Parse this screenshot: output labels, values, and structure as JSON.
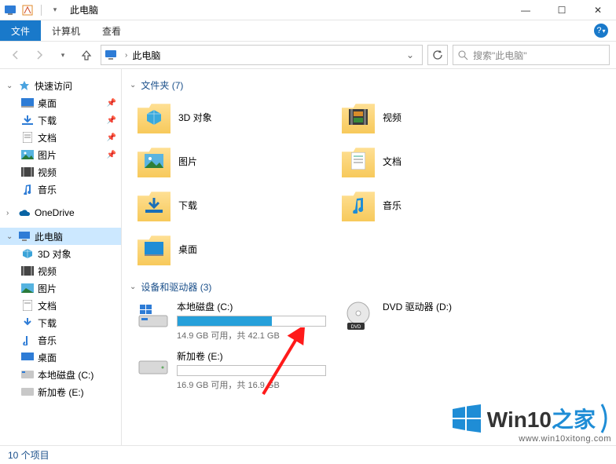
{
  "window": {
    "title": "此电脑",
    "min": "—",
    "max": "☐",
    "close": "✕"
  },
  "ribbon": {
    "file": "文件",
    "computer": "计算机",
    "view": "查看",
    "help": "?"
  },
  "address": {
    "path": "此电脑",
    "search_placeholder": "搜索\"此电脑\""
  },
  "sidebar": {
    "quick_access": "快速访问",
    "desktop": "桌面",
    "downloads": "下载",
    "documents": "文档",
    "pictures": "图片",
    "videos": "视频",
    "music": "音乐",
    "onedrive": "OneDrive",
    "this_pc": "此电脑",
    "objects3d": "3D 对象",
    "videos2": "视频",
    "pictures2": "图片",
    "documents2": "文档",
    "downloads2": "下载",
    "music2": "音乐",
    "desktop2": "桌面",
    "drive_c": "本地磁盘 (C:)",
    "drive_e": "新加卷 (E:)"
  },
  "sections": {
    "folders": {
      "title": "文件夹 (7)"
    },
    "devices": {
      "title": "设备和驱动器 (3)"
    }
  },
  "folders": {
    "objects3d": "3D 对象",
    "videos": "视频",
    "pictures": "图片",
    "documents": "文档",
    "downloads": "下载",
    "music": "音乐",
    "desktop": "桌面"
  },
  "drives": {
    "c": {
      "name": "本地磁盘 (C:)",
      "sub": "14.9 GB 可用，共 42.1 GB",
      "fill_percent": 64
    },
    "e": {
      "name": "新加卷 (E:)",
      "sub": "16.9 GB 可用，共 16.9 GB",
      "fill_percent": 0
    },
    "dvd": {
      "name": "DVD 驱动器 (D:)"
    }
  },
  "statusbar": {
    "items": "10 个项目"
  },
  "watermark": {
    "brand_a": "Win10",
    "brand_b": "之家",
    "url": "www.win10xitong.com"
  }
}
